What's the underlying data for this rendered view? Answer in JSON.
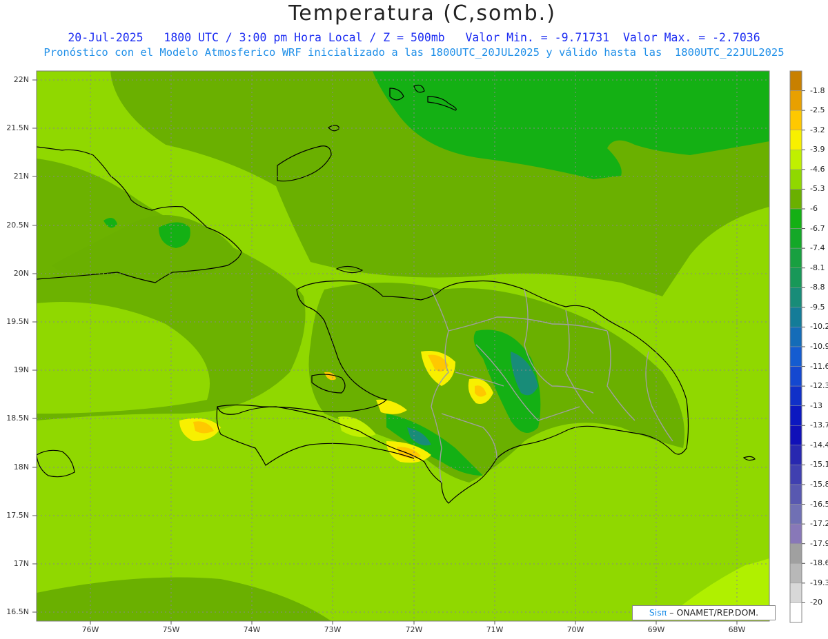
{
  "title": "Temperatura (C,somb.)",
  "subtitle": "20-Jul-2025   1800 UTC / 3:00 pm Hora Local / Z = 500mb   Valor Min. = -9.71731  Valor Max. = -2.7036",
  "subtitle2": "Pronóstico con el Modelo Atmosferico WRF inicializado a las 1800UTC_20JUL2025 y válido hasta las  1800UTC_22JUL2025",
  "credit": {
    "brand": "Sisπ",
    "text": " – ONAMET/REP.DOM."
  },
  "lat_labels": [
    "22N",
    "21.5N",
    "21N",
    "20.5N",
    "20N",
    "19.5N",
    "19N",
    "18.5N",
    "18N",
    "17.5N",
    "17N",
    "16.5N"
  ],
  "lon_labels": [
    "76W",
    "75W",
    "74W",
    "73W",
    "72W",
    "71W",
    "70W",
    "69W",
    "68W"
  ],
  "colorbar": {
    "labels": [
      "-1.8",
      "-2.5",
      "-3.2",
      "-3.9",
      "-4.6",
      "-5.3",
      "-6",
      "-6.7",
      "-7.4",
      "-8.1",
      "-8.8",
      "-9.5",
      "-10.2",
      "-10.9",
      "-11.6",
      "-12.3",
      "-13",
      "-13.7",
      "-14.4",
      "-15.1",
      "-15.8",
      "-16.5",
      "-17.2",
      "-17.9",
      "-18.6",
      "-19.3",
      "-20"
    ],
    "colors": [
      "#c88000",
      "#e8a000",
      "#ffc800",
      "#f8f000",
      "#c0f000",
      "#90d800",
      "#6ab000",
      "#14b014",
      "#14a828",
      "#18a040",
      "#189858",
      "#188c78",
      "#147c98",
      "#146cb8",
      "#145cd0",
      "#1448d0",
      "#1030c8",
      "#0c18c0",
      "#1010b8",
      "#2828b0",
      "#4040b0",
      "#5858b0",
      "#7070b4",
      "#8878b8",
      "#a0a0a0",
      "#b8b8b8",
      "#d8d8d8",
      "#ffffff"
    ]
  },
  "colors": {
    "bg_mid": "#90d800",
    "bg_dark": "#6ab000",
    "bg_light": "#b0f000",
    "dark_green": "#14b014",
    "yellow": "#f8f000",
    "orange": "#ffc800",
    "coast": "#000000",
    "border": "#a0a0a0"
  }
}
